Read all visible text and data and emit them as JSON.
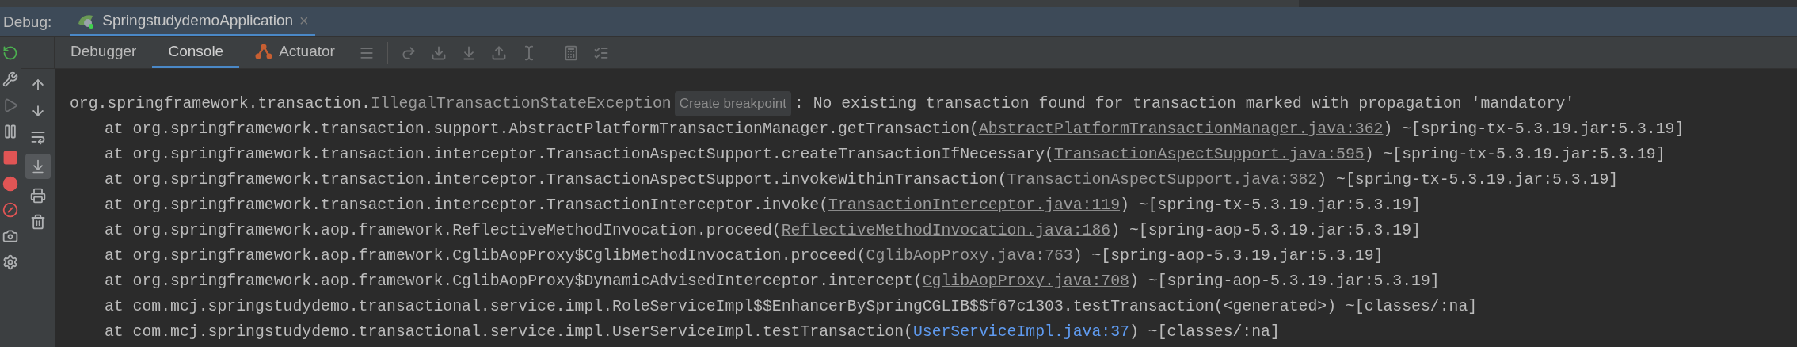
{
  "debug_bar": {
    "label": "Debug:",
    "session_tab": {
      "title": "SpringstudydemoApplication",
      "close": "×",
      "selected": true
    }
  },
  "tabs": [
    {
      "label": "Debugger",
      "selected": false
    },
    {
      "label": "Console",
      "selected": true
    },
    {
      "label": "Actuator",
      "selected": false
    }
  ],
  "console": {
    "lines": [
      {
        "kind": "exception",
        "segments": [
          {
            "kind": "plain",
            "text": "org.springframework.transaction."
          },
          {
            "kind": "link",
            "text": "IllegalTransactionStateException"
          },
          {
            "kind": "hint",
            "text": "Create breakpoint"
          },
          {
            "kind": "plain",
            "text": ": No existing transaction found for transaction marked with propagation 'mandatory'"
          }
        ]
      },
      {
        "kind": "frame",
        "segments": [
          {
            "kind": "plain",
            "text": "at org.springframework.transaction.support.AbstractPlatformTransactionManager.getTransaction("
          },
          {
            "kind": "link",
            "text": "AbstractPlatformTransactionManager.java:362"
          },
          {
            "kind": "plain",
            "text": ") ~[spring-tx-5.3.19.jar:5.3.19]"
          }
        ]
      },
      {
        "kind": "frame",
        "segments": [
          {
            "kind": "plain",
            "text": "at org.springframework.transaction.interceptor.TransactionAspectSupport.createTransactionIfNecessary("
          },
          {
            "kind": "link",
            "text": "TransactionAspectSupport.java:595"
          },
          {
            "kind": "plain",
            "text": ") ~[spring-tx-5.3.19.jar:5.3.19]"
          }
        ]
      },
      {
        "kind": "frame",
        "segments": [
          {
            "kind": "plain",
            "text": "at org.springframework.transaction.interceptor.TransactionAspectSupport.invokeWithinTransaction("
          },
          {
            "kind": "link",
            "text": "TransactionAspectSupport.java:382"
          },
          {
            "kind": "plain",
            "text": ") ~[spring-tx-5.3.19.jar:5.3.19]"
          }
        ]
      },
      {
        "kind": "frame",
        "segments": [
          {
            "kind": "plain",
            "text": "at org.springframework.transaction.interceptor.TransactionInterceptor.invoke("
          },
          {
            "kind": "link",
            "text": "TransactionInterceptor.java:119"
          },
          {
            "kind": "plain",
            "text": ") ~[spring-tx-5.3.19.jar:5.3.19]"
          }
        ]
      },
      {
        "kind": "frame",
        "segments": [
          {
            "kind": "plain",
            "text": "at org.springframework.aop.framework.ReflectiveMethodInvocation.proceed("
          },
          {
            "kind": "link",
            "text": "ReflectiveMethodInvocation.java:186"
          },
          {
            "kind": "plain",
            "text": ") ~[spring-aop-5.3.19.jar:5.3.19]"
          }
        ]
      },
      {
        "kind": "frame",
        "segments": [
          {
            "kind": "plain",
            "text": "at org.springframework.aop.framework.CglibAopProxy$CglibMethodInvocation.proceed("
          },
          {
            "kind": "link",
            "text": "CglibAopProxy.java:763"
          },
          {
            "kind": "plain",
            "text": ") ~[spring-aop-5.3.19.jar:5.3.19]"
          }
        ]
      },
      {
        "kind": "frame",
        "segments": [
          {
            "kind": "plain",
            "text": "at org.springframework.aop.framework.CglibAopProxy$DynamicAdvisedInterceptor.intercept("
          },
          {
            "kind": "link",
            "text": "CglibAopProxy.java:708"
          },
          {
            "kind": "plain",
            "text": ") ~[spring-aop-5.3.19.jar:5.3.19]"
          }
        ]
      },
      {
        "kind": "frame",
        "segments": [
          {
            "kind": "plain",
            "text": "at com.mcj.springstudydemo.transactional.service.impl.RoleServiceImpl$$EnhancerBySpringCGLIB$$f67c1303.testTransaction(<generated>) ~[classes/:na]"
          }
        ]
      },
      {
        "kind": "frame",
        "segments": [
          {
            "kind": "plain",
            "text": "at com.mcj.springstudydemo.transactional.service.impl.UserServiceImpl.testTransaction("
          },
          {
            "kind": "user_link",
            "text": "UserServiceImpl.java:37"
          },
          {
            "kind": "plain",
            "text": ") ~[classes/:na]"
          }
        ]
      }
    ]
  }
}
